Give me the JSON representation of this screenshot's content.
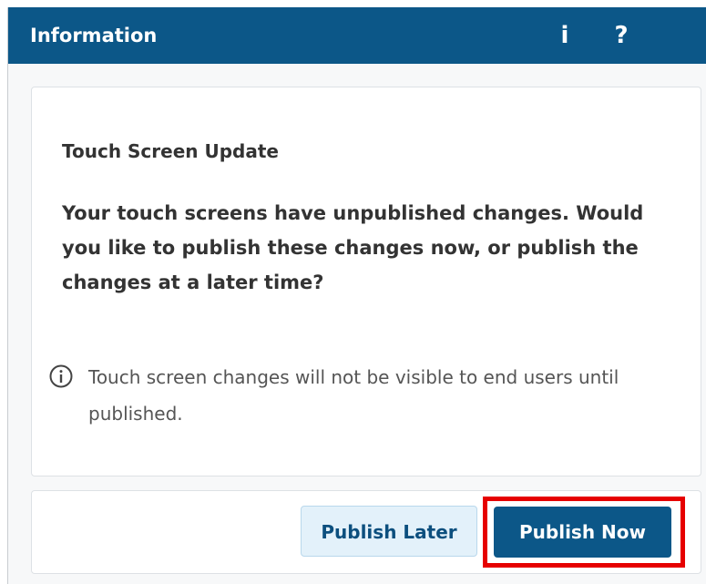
{
  "header": {
    "title": "Information",
    "info_label": "i",
    "help_label": "?"
  },
  "content": {
    "title": "Touch Screen Update",
    "message": "Your touch screens have unpublished changes. Would you like to publish these changes now, or publish the changes at a later time?",
    "note": "Touch screen changes will not be visible to end users until published."
  },
  "footer": {
    "publish_later_label": "Publish Later",
    "publish_now_label": "Publish Now"
  },
  "colors": {
    "header_bg": "#0c5788",
    "primary_button": "#0c5788",
    "secondary_button_bg": "#e3f1fa",
    "highlight": "#e60000"
  },
  "icons": {
    "note_icon": "info-circle-icon"
  }
}
